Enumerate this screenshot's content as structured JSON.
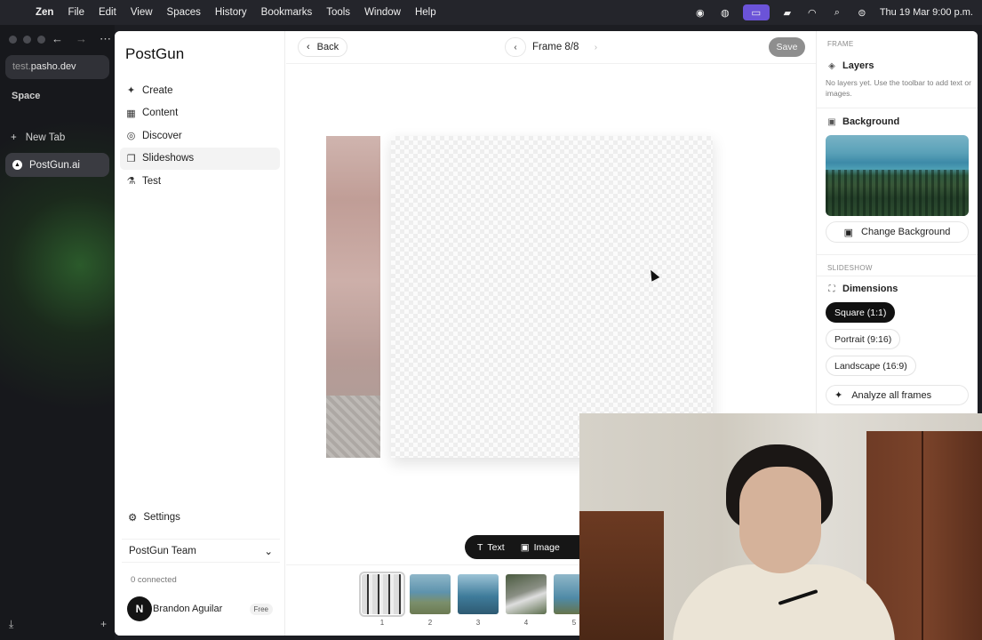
{
  "menubar": {
    "app_name": "Zen",
    "items": [
      "File",
      "Edit",
      "View",
      "Spaces",
      "History",
      "Bookmarks",
      "Tools",
      "Window",
      "Help"
    ],
    "clock": "Thu 19 Mar  9:00 p.m.",
    "tray_icons": [
      "chat-icon",
      "ball-icon",
      "screen-share-icon",
      "battery-icon",
      "wifi-icon",
      "search-icon",
      "control-center-icon"
    ]
  },
  "browser": {
    "url_sub": "test.",
    "url_main": "pasho.dev",
    "space_label": "Space",
    "new_tab_label": "New Tab",
    "active_tab": "PostGun.ai"
  },
  "app": {
    "brand": "PostGun",
    "nav": [
      {
        "label": "Create",
        "icon": "sparkle-icon"
      },
      {
        "label": "Content",
        "icon": "grid-icon"
      },
      {
        "label": "Discover",
        "icon": "compass-icon"
      },
      {
        "label": "Slideshows",
        "icon": "slides-icon"
      },
      {
        "label": "Test",
        "icon": "flask-icon"
      }
    ],
    "settings_label": "Settings",
    "team_label": "PostGun Team",
    "connected_label": "0 connected",
    "user": {
      "initial": "N",
      "name": "Brandon Aguilar",
      "plan": "Free"
    }
  },
  "editor": {
    "back_label": "Back",
    "frame_label": "Frame 8/8",
    "save_label": "Save",
    "toolbar": {
      "text_label": "Text",
      "image_label": "Image"
    },
    "thumbnails": [
      "1",
      "2",
      "3",
      "4",
      "5"
    ]
  },
  "panel": {
    "frame_caption": "FRAME",
    "layers_title": "Layers",
    "layers_hint": "No layers yet. Use the toolbar to add text or images.",
    "background_title": "Background",
    "change_background_label": "Change Background",
    "slideshow_caption": "SLIDESHOW",
    "dimensions_title": "Dimensions",
    "dimension_options": [
      "Square (1:1)",
      "Portrait (9:16)",
      "Landscape (16:9)"
    ],
    "selected_dimension": "Square (1:1)",
    "analyze_label": "Analyze all frames"
  },
  "colors": {
    "menubar_bg": "#24252b",
    "tray_accent": "#6b53d8",
    "selected_chip": "#111111",
    "save_button": "#8e8e8e"
  }
}
